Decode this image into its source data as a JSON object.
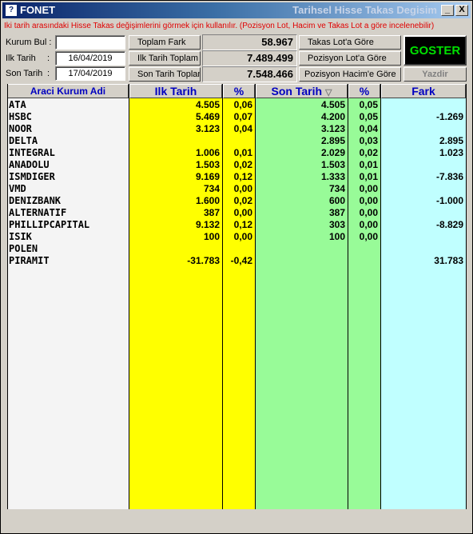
{
  "window": {
    "app_title": "FONET",
    "right_title": "Tarihsel Hisse Takas Degisim",
    "min_label": "_",
    "close_label": "X"
  },
  "info_text": "Iki tarih arasındaki Hisse Takas değişimlerini görmek için kullanılır. (Pozisyon Lot, Hacim ve Takas Lot a göre incelenebilir)",
  "form": {
    "kurum_label": "Kurum Bul :",
    "kurum_value": "",
    "ilk_tarih_label": "Ilk Tarih",
    "ilk_tarih_colon": ":",
    "ilk_tarih_value": "16/04/2019",
    "son_tarih_label": "Son Tarih",
    "son_tarih_colon": ":",
    "son_tarih_value": "17/04/2019"
  },
  "summary": {
    "toplam_fark_label": "Toplam Fark",
    "toplam_fark_value": "58.967",
    "ilk_tarih_toplam_label": "Ilk Tarih Toplam",
    "ilk_tarih_toplam_value": "7.489.499",
    "son_tarih_toplam_label": "Son Tarih Toplam",
    "son_tarih_toplam_value": "7.548.466"
  },
  "options": {
    "takas_lot": "Takas Lot'a Göre",
    "pozisyon_lot": "Pozisyon Lot'a Göre",
    "pozisyon_hacim": "Pozisyon Hacim'e Göre"
  },
  "buttons": {
    "goster": "GOSTER",
    "yazdir": "Yazdir"
  },
  "columns": {
    "kurum": "Araci Kurum Adi",
    "ilk_tarih": "Ilk Tarih",
    "ilk_pct": "%",
    "son_tarih": "Son Tarih",
    "sort_icon": "▽",
    "son_pct": "%",
    "fark": "Fark"
  },
  "colors": {
    "yellow": "#ffff00",
    "green": "#98fb98",
    "cyan": "#c0ffff",
    "name_bg": "#f4f4f4"
  },
  "rows": [
    {
      "name": "ATA",
      "ilk": "4.505",
      "ilk_pct": "0,06",
      "son": "4.505",
      "son_pct": "0,05",
      "fark": ""
    },
    {
      "name": "HSBC",
      "ilk": "5.469",
      "ilk_pct": "0,07",
      "son": "4.200",
      "son_pct": "0,05",
      "fark": "-1.269"
    },
    {
      "name": "NOOR",
      "ilk": "3.123",
      "ilk_pct": "0,04",
      "son": "3.123",
      "son_pct": "0,04",
      "fark": ""
    },
    {
      "name": "DELTA",
      "ilk": "",
      "ilk_pct": "",
      "son": "2.895",
      "son_pct": "0,03",
      "fark": "2.895"
    },
    {
      "name": "INTEGRAL",
      "ilk": "1.006",
      "ilk_pct": "0,01",
      "son": "2.029",
      "son_pct": "0,02",
      "fark": "1.023"
    },
    {
      "name": "ANADOLU",
      "ilk": "1.503",
      "ilk_pct": "0,02",
      "son": "1.503",
      "son_pct": "0,01",
      "fark": ""
    },
    {
      "name": "ISMDIGER",
      "ilk": "9.169",
      "ilk_pct": "0,12",
      "son": "1.333",
      "son_pct": "0,01",
      "fark": "-7.836"
    },
    {
      "name": "VMD",
      "ilk": "734",
      "ilk_pct": "0,00",
      "son": "734",
      "son_pct": "0,00",
      "fark": ""
    },
    {
      "name": "DENIZBANK",
      "ilk": "1.600",
      "ilk_pct": "0,02",
      "son": "600",
      "son_pct": "0,00",
      "fark": "-1.000"
    },
    {
      "name": "ALTERNATIF",
      "ilk": "387",
      "ilk_pct": "0,00",
      "son": "387",
      "son_pct": "0,00",
      "fark": ""
    },
    {
      "name": "PHILLIPCAPITAL",
      "ilk": "9.132",
      "ilk_pct": "0,12",
      "son": "303",
      "son_pct": "0,00",
      "fark": "-8.829"
    },
    {
      "name": "ISIK",
      "ilk": "100",
      "ilk_pct": "0,00",
      "son": "100",
      "son_pct": "0,00",
      "fark": ""
    },
    {
      "name": "POLEN",
      "ilk": "",
      "ilk_pct": "",
      "son": "",
      "son_pct": "",
      "fark": ""
    },
    {
      "name": "PIRAMIT",
      "ilk": "-31.783",
      "ilk_pct": "-0,42",
      "son": "",
      "son_pct": "",
      "fark": "31.783"
    }
  ]
}
